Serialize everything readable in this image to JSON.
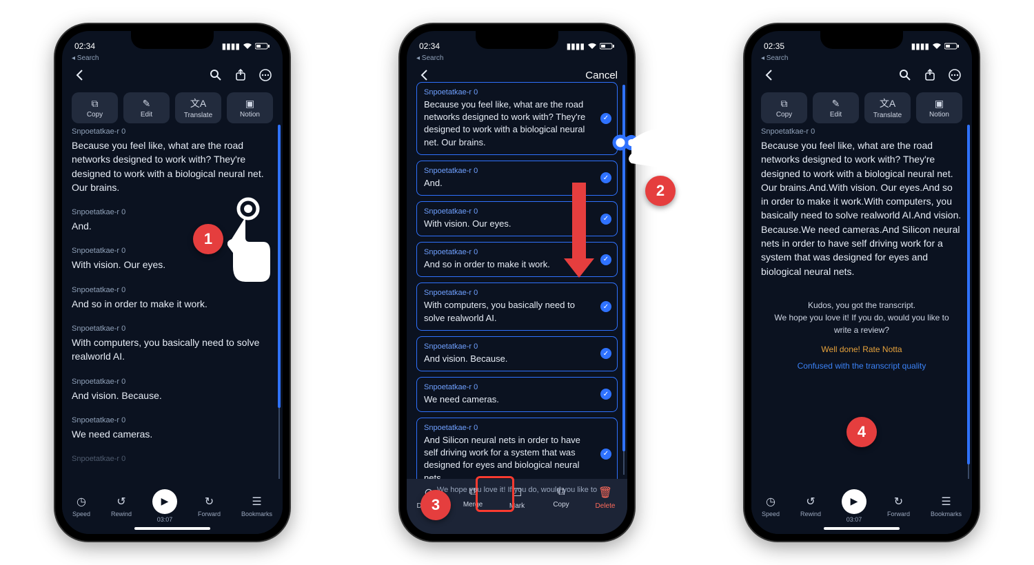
{
  "status": {
    "time_a": "02:34",
    "time_b": "02:34",
    "time_c": "02:35",
    "back_app": "◂ Search"
  },
  "nav": {
    "cancel": "Cancel"
  },
  "toolbar": {
    "copy": "Copy",
    "edit": "Edit",
    "translate": "Translate",
    "notion": "Notion"
  },
  "speaker": "Snpoetatkae-r 0",
  "segments": [
    "Because you feel like, what are the road networks designed to work with? They're designed to work with a biological neural net. Our brains.",
    "And.",
    "With vision. Our eyes.",
    "And so in order to make it work.",
    "With computers, you basically need to solve realworld AI.",
    "And vision. Because.",
    "We need cameras.",
    "And Silicon neural nets in order to have self driving work for a system that was designed for eyes and biological neural nets."
  ],
  "merged_text": "Because you feel like, what are the road networks designed to work with? They're designed to work with a biological neural net. Our brains.And.With vision. Our eyes.And so in order to make it work.With computers, you basically need to solve realworld AI.And vision. Because.We need cameras.And Silicon neural nets in order to have self driving work for a system that was designed for eyes and biological neural nets.",
  "review": {
    "line1": "Kudos, you got the transcript.",
    "line2": "We hope you love it! If you do, would you like to write a review?",
    "rate": "Well done! Rate Notta",
    "confused": "Confused with the transcript quality"
  },
  "player": {
    "speed": "Speed",
    "rewind": "Rewind",
    "time": "03:07",
    "forward": "Forward",
    "bookmarks": "Bookmarks"
  },
  "selbar": {
    "dismiss": "Dismiss",
    "merge": "Merge",
    "mark": "Mark",
    "copy": "Copy",
    "delete": "Delete"
  },
  "footnote_b": "We hope you love it! If you do, would you like to",
  "annotations": {
    "b1": "1",
    "b2": "2",
    "b3": "3",
    "b4": "4"
  }
}
